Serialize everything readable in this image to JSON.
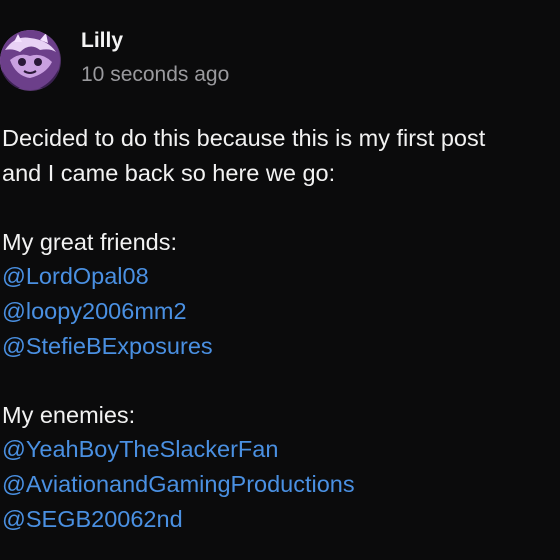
{
  "post": {
    "author": "Lilly",
    "timestamp": "10 seconds ago",
    "avatar_icon": "avatar-image",
    "text_lines": {
      "l1": "Decided to do this because this is my first post",
      "l2": "and I came back so here we go:",
      "l4": "My great friends:",
      "l8": "My enemies:"
    },
    "friends": [
      "@LordOpal08",
      "@loopy2006mm2",
      "@StefieBExposures"
    ],
    "enemies": [
      "@YeahBoyTheSlackerFan",
      "@AviationandGamingProductions",
      "@SEGB20062nd"
    ]
  },
  "colors": {
    "background": "#0b0b0c",
    "text": "#f2f2f2",
    "muted": "#9a9a9e",
    "link": "#4a90e2"
  }
}
